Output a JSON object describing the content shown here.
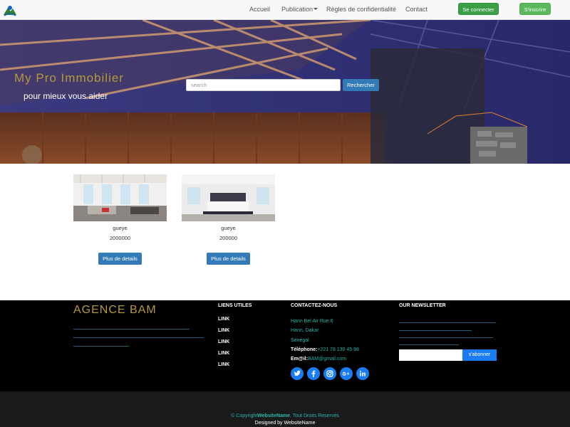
{
  "nav": {
    "links": [
      "Accueil",
      "Publication",
      "Règles de confidentialité",
      "Contact"
    ],
    "login_label": "Se connecter",
    "signup_label": "S'inscrire"
  },
  "hero": {
    "title": "My Pro Immobilier",
    "subtitle": "pour mieux vous aider",
    "search_placeholder": "search",
    "search_button": "Rechercher"
  },
  "listings": [
    {
      "name": "gueye",
      "price": "2000000",
      "button": "Plus de details"
    },
    {
      "name": "gueye",
      "price": "200000",
      "button": "Plus de details"
    }
  ],
  "footer": {
    "agency": "AGENCE BAM",
    "links_title": "LIENS UTILES",
    "links": [
      "LINK",
      "LINK",
      "LINK",
      "LINK",
      "LINK"
    ],
    "contact_title": "CONTACTEZ-NOUS",
    "address1": "Hann Bel Air Rue:6",
    "address2": "Hann, Dakar",
    "country": "Sénégal",
    "phone_label": "Téléphone:",
    "phone": "+221 78 130 45 98",
    "email_label": "Em@il:",
    "email": "BAM@gmail.com",
    "newsletter_title": "OUR NEWSLETTER",
    "subscribe_label": "s'abonner",
    "copyright_prefix": "© Copyright",
    "copyright_name": "WebsiteName",
    "copyright_suffix": ". Tout Droits Reservés",
    "designed_by": "Designed by WebsiteName"
  },
  "social_icons": [
    "twitter-icon",
    "facebook-icon",
    "instagram-icon",
    "google-plus-icon",
    "linkedin-icon"
  ],
  "colors": {
    "accent_gold": "#b59a3a",
    "primary_blue": "#337ab7",
    "teal": "#2ab5ab",
    "green": "#3c9f48"
  }
}
